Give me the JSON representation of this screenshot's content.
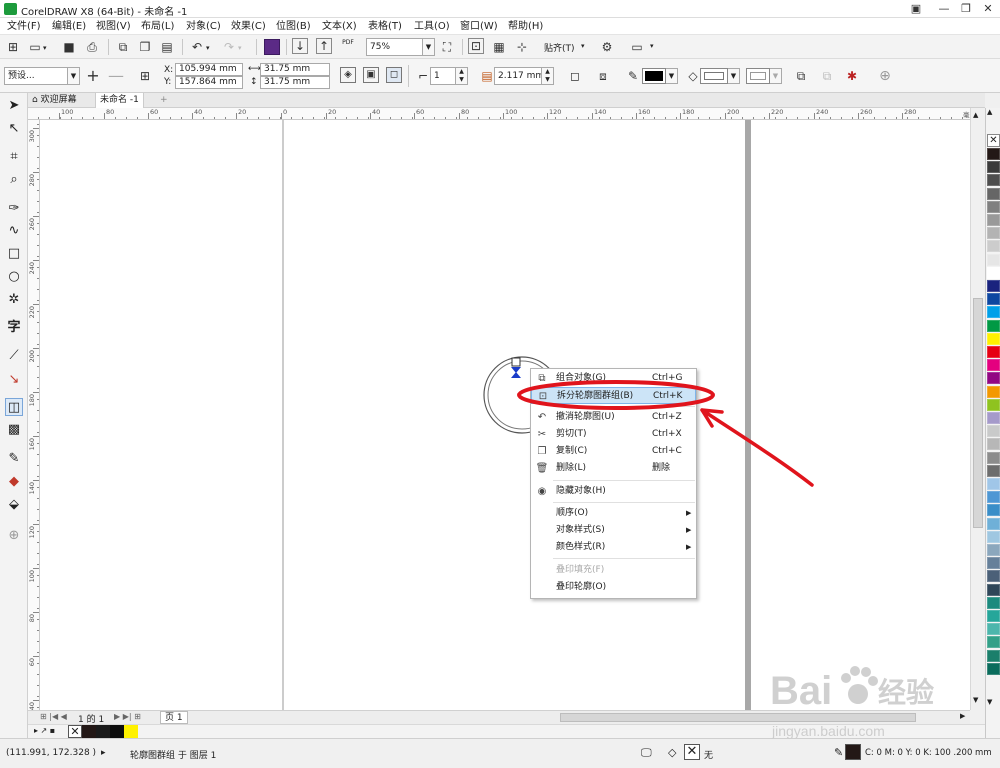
{
  "title": "CorelDRAW X8 (64-Bit) - 未命名 -1",
  "window_buttons": [
    "▣",
    "—",
    "❐",
    "✕"
  ],
  "menu": [
    "文件(F)",
    "编辑(E)",
    "视图(V)",
    "布局(L)",
    "对象(C)",
    "效果(C)",
    "位图(B)",
    "文本(X)",
    "表格(T)",
    "工具(O)",
    "窗口(W)",
    "帮助(H)"
  ],
  "toolbar1": {
    "zoom": "75%",
    "snap_label": "贴齐(T)",
    "pdf_label": "PDF"
  },
  "toolbar2": {
    "preset": "预设...",
    "x_label": "X:",
    "x_value": "105.994 mm",
    "y_label": "Y:",
    "y_value": "157.864 mm",
    "width_value": "31.75 mm",
    "height_value": "31.75 mm",
    "groups_value": "1",
    "outline_width": "2.117 mm"
  },
  "tabs": {
    "welcome": "欢迎屏幕",
    "doc": "未命名 -1",
    "add": "+"
  },
  "ruler": {
    "h_labels": [
      "100",
      "80",
      "60",
      "40",
      "20",
      "0",
      "20",
      "40",
      "60",
      "80",
      "100",
      "120",
      "140",
      "160",
      "180",
      "200",
      "220",
      "240",
      "260",
      "280"
    ],
    "unit": "毫米",
    "v_labels": [
      "300",
      "280",
      "260",
      "240",
      "220",
      "200",
      "180",
      "160",
      "140",
      "120",
      "100",
      "80",
      "60",
      "40",
      "20"
    ]
  },
  "context_menu": [
    {
      "icon": "group-icon",
      "label": "组合对象(G)",
      "shortcut": "Ctrl+G",
      "state": "normal"
    },
    {
      "icon": "break-apart-icon",
      "label": "拆分轮廓图群组(B)",
      "shortcut": "Ctrl+K",
      "state": "highlighted"
    },
    {
      "icon": "undo-icon",
      "label": "撤消轮廓图(U)",
      "shortcut": "Ctrl+Z",
      "state": "normal"
    },
    {
      "icon": "cut-icon",
      "label": "剪切(T)",
      "shortcut": "Ctrl+X",
      "state": "normal"
    },
    {
      "icon": "copy-icon",
      "label": "复制(C)",
      "shortcut": "Ctrl+C",
      "state": "normal"
    },
    {
      "icon": "delete-icon",
      "label": "删除(L)",
      "shortcut": "删除",
      "state": "normal"
    },
    {
      "icon": "hide-icon",
      "label": "隐藏对象(H)",
      "shortcut": "",
      "state": "normal"
    },
    {
      "icon": "",
      "label": "顺序(O)",
      "shortcut": "",
      "state": "submenu"
    },
    {
      "icon": "",
      "label": "对象样式(S)",
      "shortcut": "",
      "state": "submenu"
    },
    {
      "icon": "",
      "label": "颜色样式(R)",
      "shortcut": "",
      "state": "submenu"
    },
    {
      "icon": "",
      "label": "叠印填充(F)",
      "shortcut": "",
      "state": "disabled"
    },
    {
      "icon": "",
      "label": "叠印轮廓(O)",
      "shortcut": "",
      "state": "normal"
    }
  ],
  "page_nav": {
    "page_of": "1 的 1",
    "page_tab": "页 1"
  },
  "status": {
    "coords": "(111.991, 172.328 )",
    "object_info": "轮廓图群组 于 图层 1",
    "fill_none": "无",
    "color_info": "C: 0 M: 0 Y: 0 K: 100  .200 mm"
  },
  "colors": {
    "highlight_ring": "#e0141c",
    "palette": [
      "#231816",
      "#3a3a3a",
      "#4d4d4d",
      "#666666",
      "#808080",
      "#999999",
      "#b3b3b3",
      "#cccccc",
      "#e6e6e6",
      "#ffffff",
      "#1a237e",
      "#0d47a1",
      "#00a0e9",
      "#009944",
      "#fff100",
      "#e60012",
      "#e4007f",
      "#920783",
      "#f39800",
      "#8fc31f",
      "#a59aca",
      "#c9caca",
      "#b7b7b7",
      "#8c8c8c",
      "#6d6d6d",
      "#a0c6e8",
      "#4e97d4",
      "#3a8ec8",
      "#6fb0d8",
      "#9fc7e1",
      "#8ba7bd",
      "#66809a",
      "#4b6078",
      "#2f4659",
      "#1c8a7e",
      "#26a69a",
      "#4db6ac",
      "#33a088",
      "#1b7f6b",
      "#0a6c5c"
    ]
  },
  "watermark": {
    "brand": "Bai",
    "brand2": "经验",
    "url": "jingyan.baidu.com"
  }
}
